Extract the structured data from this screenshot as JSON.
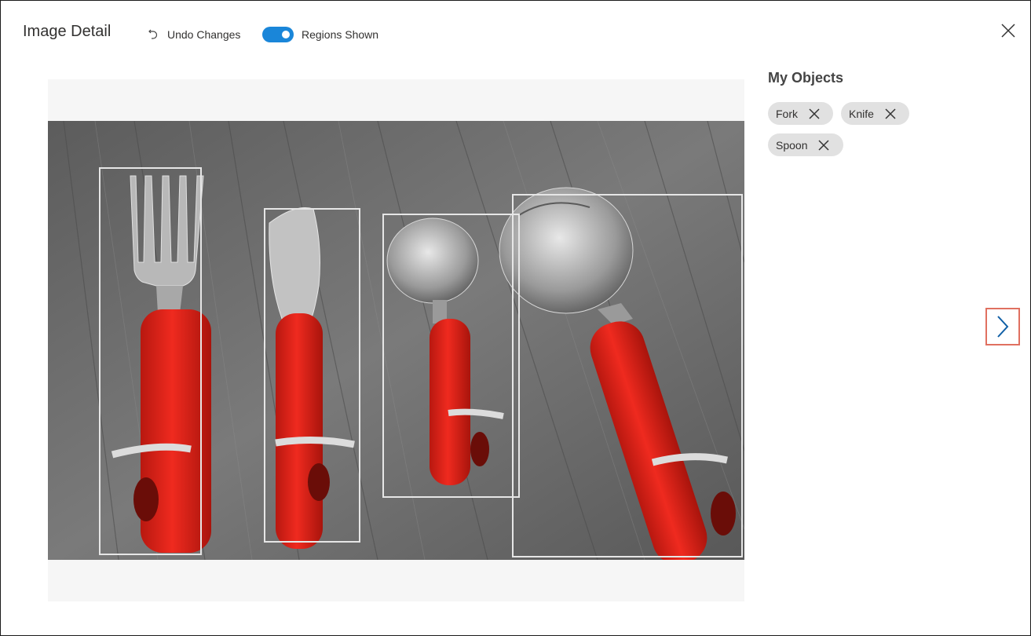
{
  "header": {
    "title": "Image Detail",
    "undo_label": "Undo Changes",
    "toggle_label": "Regions Shown",
    "toggle_on": true
  },
  "sidebar": {
    "title": "My Objects",
    "tags": [
      {
        "label": "Fork"
      },
      {
        "label": "Knife"
      },
      {
        "label": "Spoon"
      }
    ]
  },
  "regions": [
    "Fork",
    "Knife",
    "Spoon",
    "Spoon"
  ],
  "colors": {
    "accent": "#1a86d9",
    "handle": "#e0241b",
    "chip_bg": "#e1e1e1",
    "next_highlight": "#e07060",
    "next_arrow": "#0f5fa6"
  },
  "icons": {
    "undo": "undo-icon",
    "close": "close-icon",
    "remove_tag": "close-icon",
    "next": "chevron-right-icon"
  }
}
